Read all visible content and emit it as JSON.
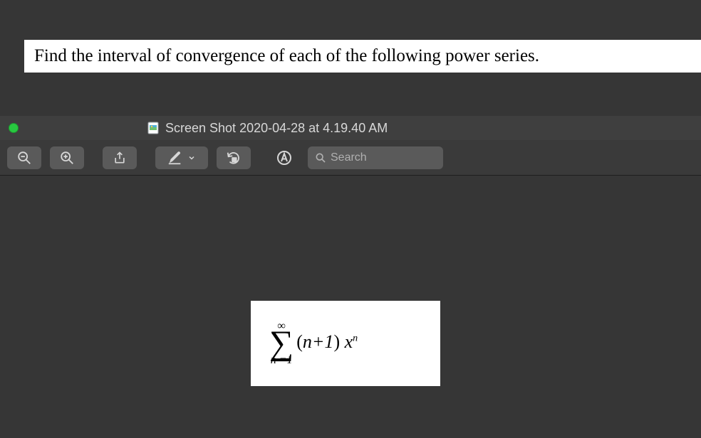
{
  "question": {
    "text": "Find the interval of convergence of each of the following power series."
  },
  "window": {
    "title": "Screen Shot 2020-04-28 at 4.19.40 AM"
  },
  "toolbar": {
    "zoom_out": "Zoom Out",
    "zoom_in": "Zoom In",
    "share": "Share",
    "markup": "Markup",
    "rotate": "Rotate",
    "highlight_tool": "Highlight",
    "search_placeholder": "Search"
  },
  "formula": {
    "sigma_upper": "∞",
    "sigma_lower": "n =1",
    "expression_open": "(",
    "expression_body": "n+1",
    "expression_close": ")",
    "variable": "x",
    "exponent": "n"
  }
}
